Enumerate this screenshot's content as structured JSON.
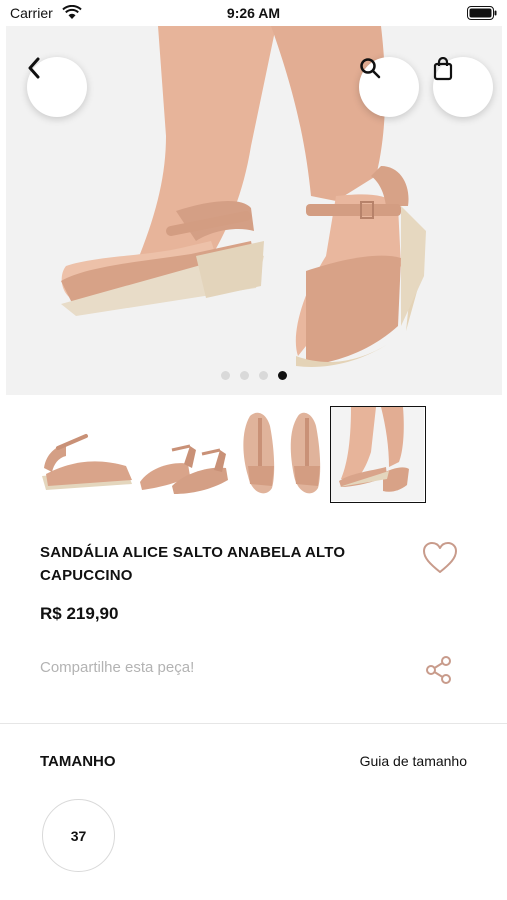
{
  "status_bar": {
    "carrier": "Carrier",
    "time": "9:26 AM"
  },
  "gallery": {
    "image_count": 4,
    "active_index": 3,
    "selected_thumbnail": 3
  },
  "product": {
    "name": "SANDÁLIA ALICE SALTO ANABELA ALTO CAPUCCINO",
    "price": "R$ 219,90",
    "share_label": "Compartilhe esta peça!"
  },
  "size": {
    "heading": "TAMANHO",
    "guide_link": "Guia de tamanho",
    "options": [
      "37"
    ]
  },
  "colors": {
    "accent": "#c89b8b",
    "product_tan": "#d9a48a",
    "text": "#111111"
  }
}
